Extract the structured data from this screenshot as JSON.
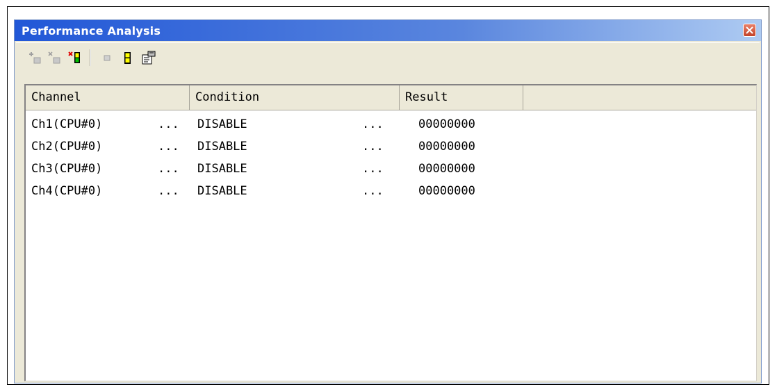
{
  "window": {
    "title": "Performance Analysis"
  },
  "titlebar": {
    "close_icon": "close-icon",
    "close_color": "#d4502f"
  },
  "toolbar": {
    "buttons": [
      {
        "icon": "add-channel-icon",
        "enabled": false
      },
      {
        "icon": "delete-channel-icon",
        "enabled": false
      },
      {
        "icon": "delete-all-channels-icon",
        "enabled": true
      },
      {
        "icon": "stop-measurement-icon",
        "enabled": false
      },
      {
        "icon": "start-measurement-icon",
        "enabled": true
      },
      {
        "icon": "properties-icon",
        "enabled": true
      }
    ]
  },
  "table": {
    "columns": [
      "Channel",
      "Condition",
      "Result"
    ],
    "rows": [
      {
        "channel": "Ch1(CPU#0)",
        "sep1": "...",
        "condition": "DISABLE",
        "sep2": "...",
        "result": "00000000"
      },
      {
        "channel": "Ch2(CPU#0)",
        "sep1": "...",
        "condition": "DISABLE",
        "sep2": "...",
        "result": "00000000"
      },
      {
        "channel": "Ch3(CPU#0)",
        "sep1": "...",
        "condition": "DISABLE",
        "sep2": "...",
        "result": "00000000"
      },
      {
        "channel": "Ch4(CPU#0)",
        "sep1": "...",
        "condition": "DISABLE",
        "sep2": "...",
        "result": "00000000"
      }
    ]
  },
  "colors": {
    "titlebar_start": "#2157d7",
    "titlebar_end": "#aecbf2",
    "window_face": "#ece9d8"
  }
}
